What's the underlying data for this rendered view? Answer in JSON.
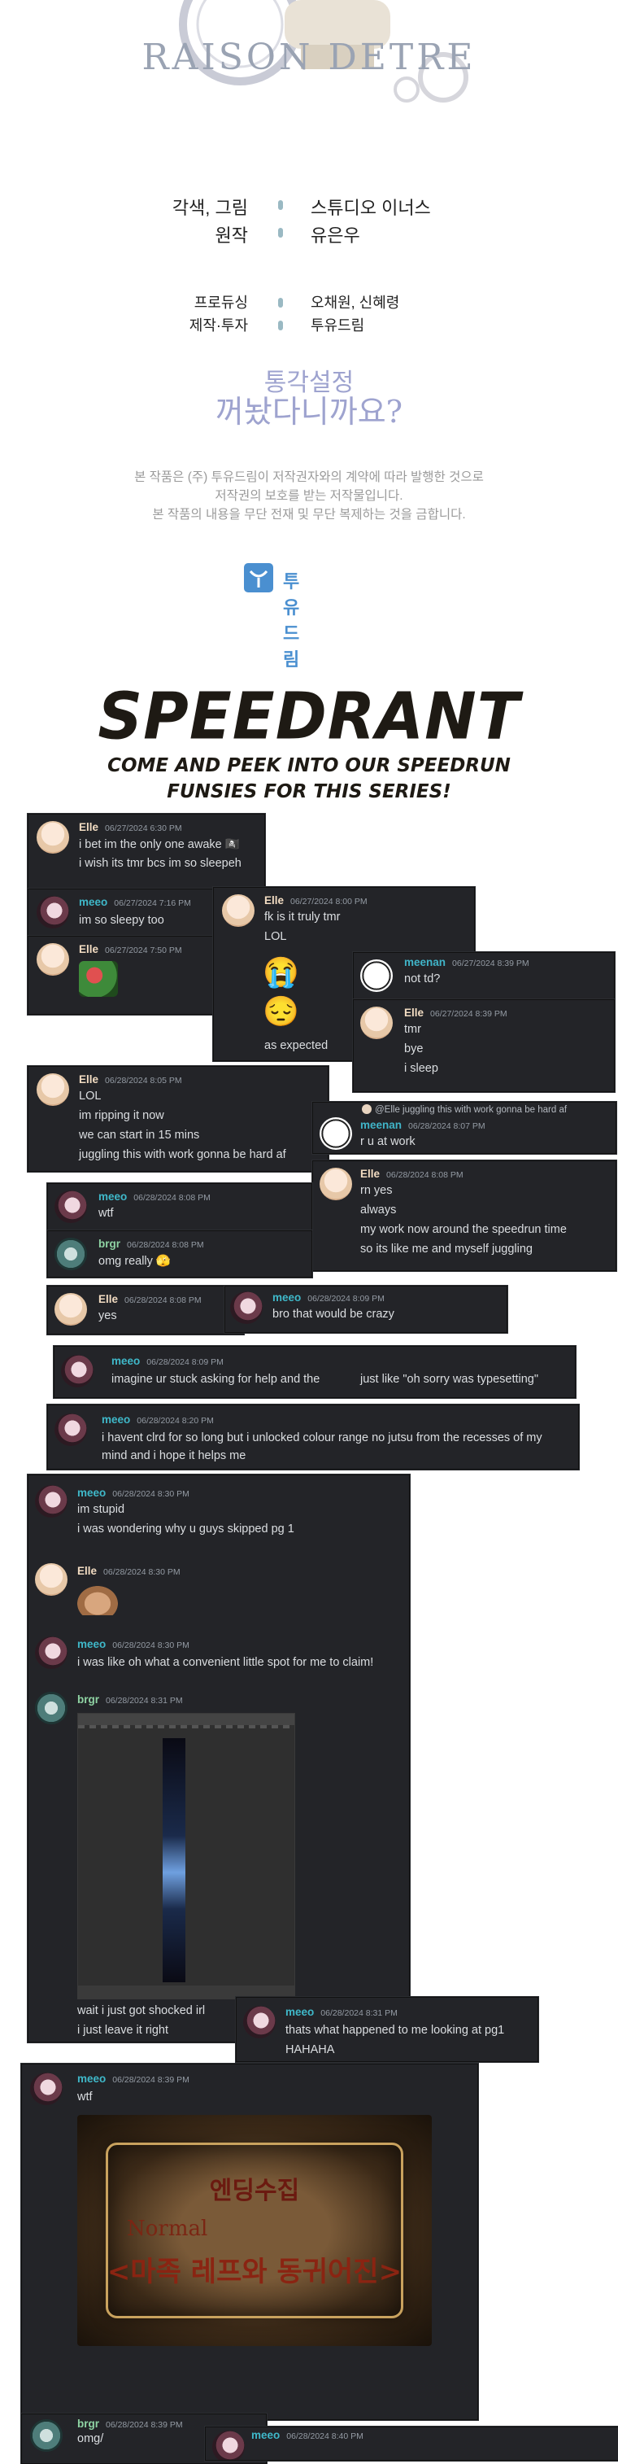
{
  "header": {
    "logo_text": "RAISON DETRE",
    "credits": [
      {
        "role": "각색, 그림",
        "name": "스튜디오 이너스"
      },
      {
        "role": "원작",
        "name": "유은우"
      }
    ],
    "production": [
      {
        "role": "프로듀싱",
        "name": "오채원, 신혜령"
      },
      {
        "role": "제작·투자",
        "name": "투유드림"
      }
    ],
    "sub_logo": {
      "line1": "통각설정",
      "line2": "꺼놨다니까요?"
    },
    "copyright": [
      "본 작품은 (주) 투유드림이 저작권자와의 계약에 따라 발행한 것으로",
      "저작권의 보호를 받는 저작물입니다.",
      "본 작품의 내용을 무단 전재 및 무단 복제하는 것을 금합니다."
    ],
    "brand": "투유드림"
  },
  "speedrant": {
    "title": "SPEEDRANT",
    "subtitle_line1": "COME AND PEEK INTO OUR SPEEDRUN",
    "subtitle_line2": "FUNSIES FOR THIS SERIES!"
  },
  "chat": {
    "p1": {
      "user": "Elle",
      "time": "06/27/2024 6:30 PM",
      "line1": "i bet im the only one awake 🏴‍☠️",
      "line2": "i wish its tmr bcs im so sleepeh"
    },
    "p2": {
      "user": "meeo",
      "time": "06/27/2024 7:16 PM",
      "line1": "im so sleepy too"
    },
    "p3": {
      "user": "Elle",
      "time": "06/27/2024 7:50 PM"
    },
    "p4": {
      "user": "Elle",
      "time": "06/27/2024 8:00 PM",
      "line1": "fk is it truly tmr",
      "line2": "LOL",
      "emoji1": "😭",
      "emoji2": "😔",
      "line3": "as expected"
    },
    "p5": {
      "user": "meenan",
      "time": "06/27/2024 8:39 PM",
      "line1": "not td?"
    },
    "p6": {
      "user": "Elle",
      "time": "06/27/2024 8:39 PM",
      "line1": "tmr",
      "line2": "bye",
      "line3": "i sleep"
    },
    "p7": {
      "user": "Elle",
      "time": "06/28/2024 8:05 PM",
      "line1": "LOL",
      "line2": "im ripping it now",
      "line3": "we can start in 15 mins",
      "line4": "juggling this with work gonna be hard af"
    },
    "p8": {
      "reply": "@Elle juggling this with work gonna be hard af",
      "user": "meenan",
      "time": "06/28/2024 8:07 PM",
      "line1": "r u at work"
    },
    "p9": {
      "user": "Elle",
      "time": "06/28/2024 8:08 PM",
      "line1": "rn yes",
      "line2": "always",
      "line3": "my work now around the speedrun time",
      "line4": "so its like me and myself juggling"
    },
    "p10": {
      "user": "meeo",
      "time": "06/28/2024 8:08 PM",
      "line1": "wtf"
    },
    "p11": {
      "user": "brgr",
      "time": "06/28/2024 8:08 PM",
      "line1": "omg really 🫣"
    },
    "p12": {
      "user": "Elle",
      "time": "06/28/2024 8:08 PM",
      "line1": "yes"
    },
    "p13": {
      "user": "meeo",
      "time": "06/28/2024 8:09 PM",
      "line1": "bro that would be crazy"
    },
    "p14": {
      "user": "meeo",
      "time": "06/28/2024 8:09 PM",
      "line1": "imagine ur stuck asking for help and the",
      "line2": "just like \"oh sorry was typesetting\""
    },
    "p15": {
      "user": "meeo",
      "time": "06/28/2024 8:20 PM",
      "line1": "i havent clrd for so long but i unlocked colour range no jutsu from the recesses of my",
      "line2": "mind and i hope it helps me"
    },
    "p16": {
      "user": "meeo",
      "time": "06/28/2024 8:30 PM",
      "line1": "im stupid",
      "line2": "i was wondering why u guys skipped pg 1"
    },
    "p17": {
      "user": "Elle",
      "time": "06/28/2024 8:30 PM"
    },
    "p18": {
      "user": "meeo",
      "time": "06/28/2024 8:30 PM",
      "line1": "i was like oh what a convenient little spot for me to claim!"
    },
    "p19": {
      "user": "brgr",
      "time": "06/28/2024 8:31 PM",
      "line1": "wait i just got shocked irl",
      "line2": "i just leave it right"
    },
    "p20": {
      "user": "meeo",
      "time": "06/28/2024 8:31 PM",
      "line1": "thats what happened to me looking at pg1",
      "line2": "HAHAHA"
    },
    "p21": {
      "user": "meeo",
      "time": "06/28/2024 8:39 PM",
      "line1": "wtf",
      "ending_title": "엔딩수집",
      "ending_mode": "Normal",
      "ending_name": "<마족 레프와 동귀어진>"
    },
    "p22": {
      "user": "brgr",
      "time": "06/28/2024 8:39 PM",
      "line1": "omg/"
    },
    "p23": {
      "user": "meeo",
      "time": "06/28/2024 8:40 PM"
    }
  }
}
